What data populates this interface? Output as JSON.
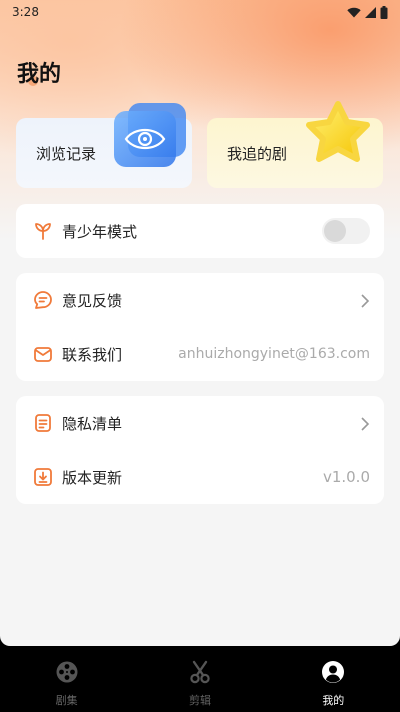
{
  "status_bar": {
    "time": "3:28"
  },
  "page": {
    "title": "我的"
  },
  "cards": {
    "history_label": "浏览记录",
    "follow_label": "我追的剧"
  },
  "sections": {
    "teen_mode": {
      "label": "青少年模式",
      "enabled": false
    },
    "feedback": {
      "label": "意见反馈"
    },
    "contact": {
      "label": "联系我们",
      "value": "anhuizhongyinet@163.com"
    },
    "privacy": {
      "label": "隐私清单"
    },
    "version": {
      "label": "版本更新",
      "value": "v1.0.0"
    }
  },
  "nav": {
    "items": [
      {
        "label": "剧集",
        "icon": "film-reel-icon",
        "active": false
      },
      {
        "label": "剪辑",
        "icon": "scissors-icon",
        "active": false
      },
      {
        "label": "我的",
        "icon": "user-icon",
        "active": true
      }
    ]
  },
  "colors": {
    "accent": "#f07a3a",
    "card_history_bg": "#eef3fb",
    "card_follow_bg": "#fdf5cf"
  }
}
